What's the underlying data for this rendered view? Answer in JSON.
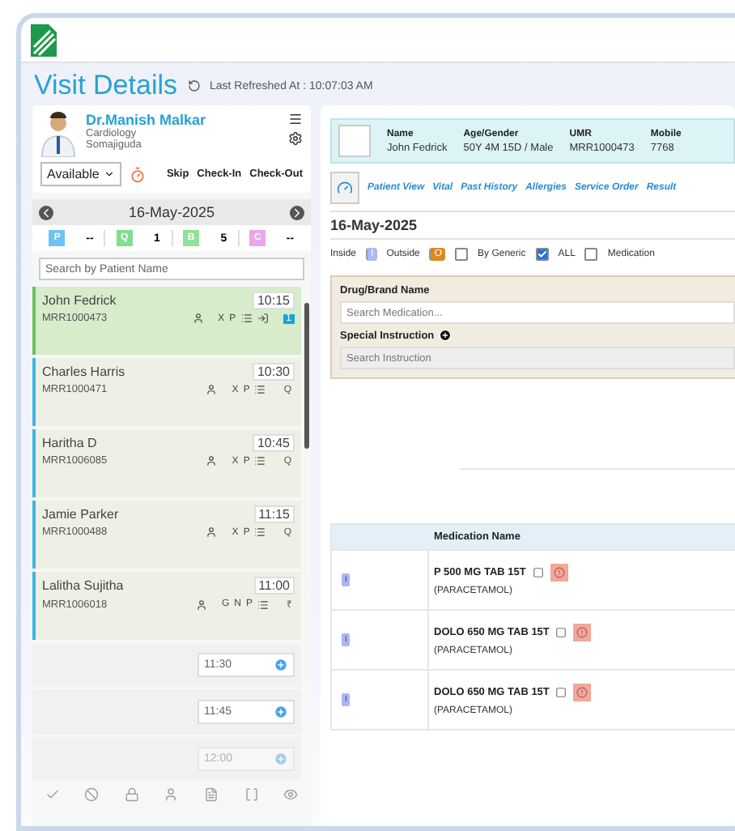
{
  "header": {
    "title": "Visit Details",
    "refreshed": "Last Refreshed At : 10:07:03 AM"
  },
  "doctor": {
    "name": "Dr.Manish Malkar",
    "department": "Cardiology",
    "location": "Somajiguda",
    "status": "Available",
    "actions": [
      "Skip",
      "Check-In",
      "Check-Out"
    ]
  },
  "date_bar": {
    "date": "16-May-2025"
  },
  "counters": [
    {
      "letter": "P",
      "count": "--",
      "color": "#6ec3f4"
    },
    {
      "letter": "Q",
      "count": "1",
      "color": "#7ee08a"
    },
    {
      "letter": "B",
      "count": "5",
      "color": "#8ee29a"
    },
    {
      "letter": "C",
      "count": "--",
      "color": "#e9a6ec"
    }
  ],
  "search": {
    "placeholder": "Search by Patient Name"
  },
  "appointments": [
    {
      "kind": "patient",
      "name": "John Fedrick",
      "umr": "MRR1000473",
      "time": "10:15",
      "flags": [
        "X",
        "P"
      ],
      "end": "1",
      "end_badge": true,
      "selected": true
    },
    {
      "kind": "patient",
      "name": "Charles Harris",
      "umr": "MRR1000471",
      "time": "10:30",
      "flags": [
        "X",
        "P"
      ],
      "end": "Q",
      "end_badge": false,
      "selected": false
    },
    {
      "kind": "patient",
      "name": "Haritha D",
      "umr": "MRR1006085",
      "time": "10:45",
      "flags": [
        "X",
        "P"
      ],
      "end": "Q",
      "end_badge": false,
      "selected": false
    },
    {
      "kind": "patient",
      "name": "Jamie Parker",
      "umr": "MRR1000488",
      "time": "11:15",
      "flags": [
        "X",
        "P"
      ],
      "end": "Q",
      "end_badge": false,
      "selected": false
    },
    {
      "kind": "patient",
      "name": "Lalitha Sujitha",
      "umr": "MRR1006018",
      "time": "11:00",
      "flags": [
        "G",
        "N",
        "P"
      ],
      "end": "₹",
      "end_badge": false,
      "selected": false
    },
    {
      "kind": "slot",
      "time": "11:30",
      "disabled": false
    },
    {
      "kind": "slot",
      "time": "11:45",
      "disabled": false
    },
    {
      "kind": "slot",
      "time": "12:00",
      "disabled": true
    }
  ],
  "patient_bar": [
    {
      "label": "Name",
      "value": "John Fedrick"
    },
    {
      "label": "Age/Gender",
      "value": "50Y 4M 15D / Male"
    },
    {
      "label": "UMR",
      "value": "MRR1000473"
    },
    {
      "label": "Mobile",
      "value": "7768"
    }
  ],
  "tabs": [
    "Patient View",
    "Vital",
    "Past History",
    "Allergies",
    "Service Order",
    "Result"
  ],
  "visit_date": "16-May-2025",
  "filters": [
    {
      "kind": "badge",
      "label": "Inside",
      "badge": "I",
      "color": "#aab8f5"
    },
    {
      "kind": "badge",
      "label": "Outside",
      "badge": "O",
      "color": "#d98a1e"
    },
    {
      "kind": "checkbox",
      "label": "By Generic",
      "checked": false
    },
    {
      "kind": "checkbox",
      "label": "ALL",
      "checked": true
    },
    {
      "kind": "checkbox",
      "label": "Medication",
      "checked": false
    }
  ],
  "form": {
    "drug_label": "Drug/Brand Name",
    "drug_placeholder": "Search Medication...",
    "instruction_label": "Special Instruction",
    "instruction_placeholder": "Search Instruction"
  },
  "table": {
    "columns": [
      "Medication Name"
    ],
    "rows": [
      {
        "tag": "I",
        "name": "P 500 MG TAB 15T",
        "generic": "(PARACETAMOL)"
      },
      {
        "tag": "I",
        "name": "DOLO 650 MG TAB 15T",
        "generic": "(PARACETAMOL)"
      },
      {
        "tag": "I",
        "name": "DOLO 650 MG TAB 15T",
        "generic": "(PARACETAMOL)"
      }
    ]
  }
}
